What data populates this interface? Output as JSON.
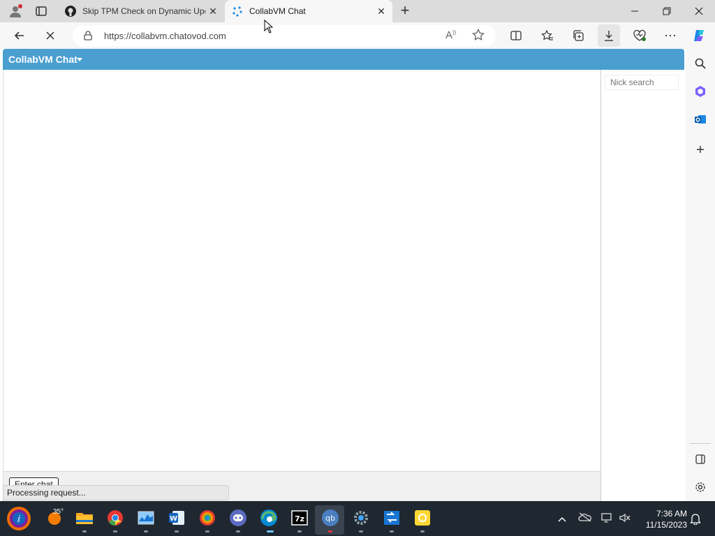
{
  "browser": {
    "tabs": [
      {
        "title": "Skip TPM Check on Dynamic Upd",
        "favicon": "github-icon"
      },
      {
        "title": "CollabVM Chat",
        "favicon": "collabvm-icon"
      }
    ],
    "new_tab_label": "+",
    "url": "https://collabvm.chatovod.com"
  },
  "page": {
    "chat_title": "CollabVM Chat",
    "nick_search_placeholder": "Nick search",
    "enter_chat_label": "Enter chat",
    "status": "Processing request..."
  },
  "taskbar": {
    "weather": "35°",
    "time": "7:36 AM",
    "date": "11/15/2023"
  },
  "colors": {
    "header": "#4a9fd0",
    "taskbar": "#1f2730",
    "tabstrip": "#dcdcdc"
  }
}
